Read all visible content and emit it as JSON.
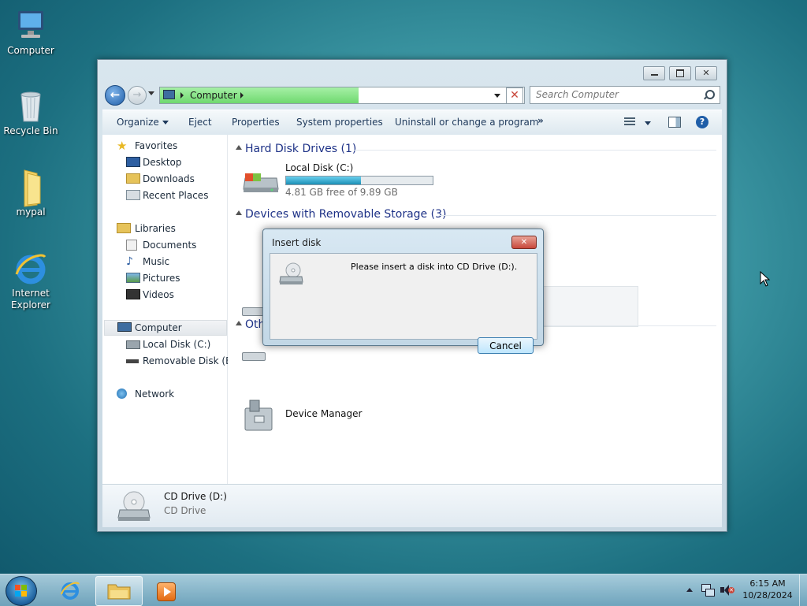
{
  "desktop": {
    "icons": [
      {
        "label": "Computer"
      },
      {
        "label": "Recycle Bin"
      },
      {
        "label": "mypal"
      },
      {
        "label": "Internet Explorer"
      }
    ]
  },
  "window": {
    "address": {
      "crumb": "Computer"
    },
    "search_placeholder": "Search Computer",
    "toolbar": {
      "organize": "Organize",
      "eject": "Eject",
      "properties": "Properties",
      "system_properties": "System properties",
      "uninstall": "Uninstall or change a program",
      "more": "»"
    },
    "nav": {
      "favorites": "Favorites",
      "desktop": "Desktop",
      "downloads": "Downloads",
      "recent_places": "Recent Places",
      "libraries": "Libraries",
      "documents": "Documents",
      "music": "Music",
      "pictures": "Pictures",
      "videos": "Videos",
      "computer": "Computer",
      "local_disk": "Local Disk (C:)",
      "removable_disk": "Removable Disk (E:)",
      "network": "Network"
    },
    "content": {
      "hdd_group": "Hard Disk Drives (1)",
      "local_disk_name": "Local Disk (C:)",
      "local_disk_free": "4.81 GB free of 9.89 GB",
      "local_disk_used_fraction": 0.513,
      "removable_group": "Devices with Removable Storage (3)",
      "other_group_partial": "Oth",
      "device_manager": "Device Manager"
    },
    "details": {
      "name": "CD Drive (D:)",
      "type": "CD Drive"
    }
  },
  "dialog": {
    "title": "Insert disk",
    "message": "Please insert a disk into CD Drive (D:).",
    "cancel": "Cancel"
  },
  "taskbar": {
    "time": "6:15 AM",
    "date": "10/28/2024"
  },
  "colors": {
    "accent_link": "#1e3287",
    "progress_fill": "#1c8fb6",
    "close_red": "#c9483c"
  }
}
